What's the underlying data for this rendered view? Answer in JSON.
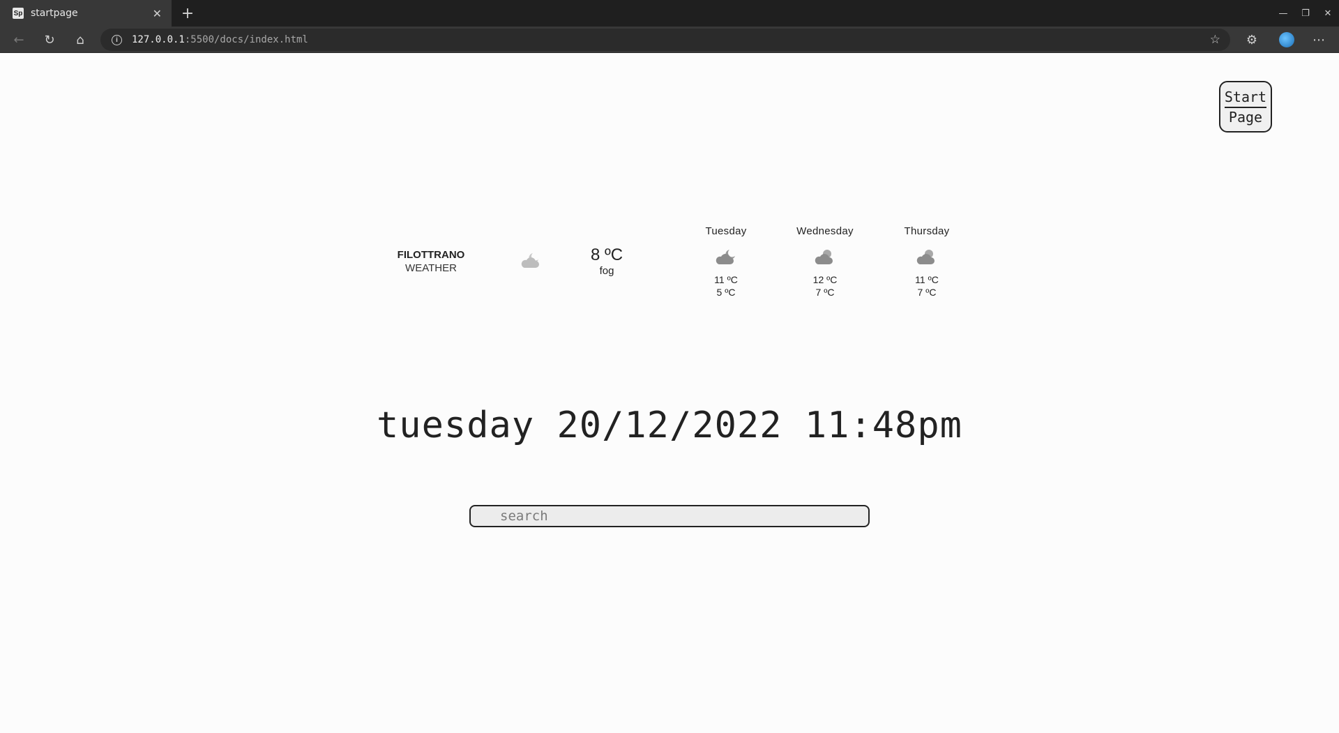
{
  "browser": {
    "tab_title": "startpage",
    "favicon_text": "Sp",
    "url_host": "127.0.0.1",
    "url_path": ":5500/docs/index.html"
  },
  "logo": {
    "line1": "Start",
    "line2": "Page"
  },
  "weather": {
    "city": "FILOTTRANO",
    "label": "WEATHER",
    "current": {
      "temp": "8 ºC",
      "desc": "fog",
      "icon": "partly-cloudy-night-icon"
    },
    "forecast": [
      {
        "day": "Tuesday",
        "high": "11 ºC",
        "low": "5 ºC",
        "icon": "partly-cloudy-night-icon"
      },
      {
        "day": "Wednesday",
        "high": "12 ºC",
        "low": "7 ºC",
        "icon": "cloudy-icon"
      },
      {
        "day": "Thursday",
        "high": "11 ºC",
        "low": "7 ºC",
        "icon": "cloudy-icon"
      }
    ]
  },
  "clock": {
    "text": "tuesday 20/12/2022 11:48pm"
  },
  "search": {
    "placeholder": "search",
    "value": ""
  }
}
